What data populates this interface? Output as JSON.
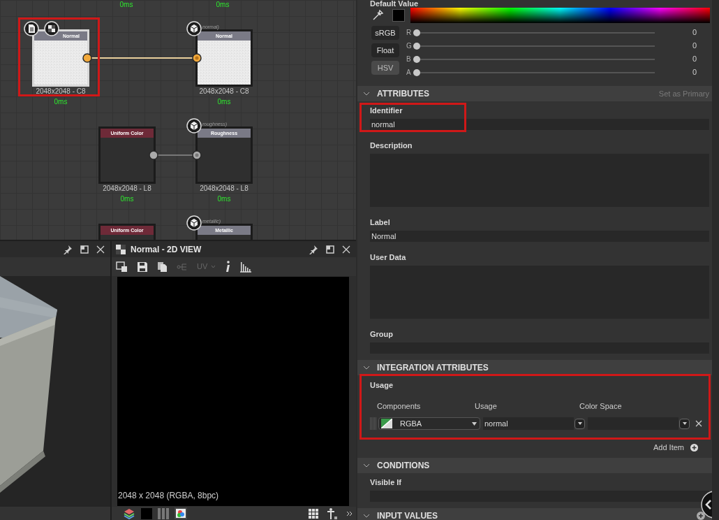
{
  "graph": {
    "top_times": [
      "0ms",
      "0ms"
    ],
    "nodes": [
      {
        "kind": "input",
        "title": "Normal",
        "color": "#7a7a86",
        "light_preview": true,
        "selected": true,
        "highlighted": true,
        "size_label": "2048x2048 - C8",
        "time": "0ms"
      },
      {
        "kind": "output",
        "title": "Normal",
        "subtitle": "normal)",
        "color": "#7a7a86",
        "light_preview": true,
        "selected": false,
        "highlighted": false,
        "size_label": "2048x2048 - C8",
        "time": "0ms"
      },
      {
        "kind": "uniform",
        "title": "Uniform Color",
        "color": "#6e2a38",
        "light_preview": false,
        "selected": false,
        "highlighted": false,
        "size_label": "2048x2048 - L8",
        "time": "0ms"
      },
      {
        "kind": "output",
        "title": "Roughness",
        "subtitle": "roughness)",
        "color": "#7a7a86",
        "light_preview": false,
        "selected": false,
        "highlighted": false,
        "size_label": "2048x2048 - L8",
        "time": "0ms"
      },
      {
        "kind": "uniform",
        "title": "Uniform Color",
        "color": "#6e2a38",
        "light_preview": false,
        "selected": false,
        "highlighted": false
      },
      {
        "kind": "output",
        "title": "Metallic",
        "subtitle": "metallic)",
        "color": "#7a7a86",
        "light_preview": false,
        "selected": false,
        "highlighted": false
      }
    ]
  },
  "view_2d": {
    "title": "Normal - 2D VIEW",
    "uv_selector": {
      "label": "UV",
      "disabled": true
    },
    "image_info": "2048 x 2048 (RGBA, 8bpc)"
  },
  "properties": {
    "default_value": {
      "label": "Default Value",
      "color": "#000000",
      "modes": [
        {
          "label": "sRGB",
          "selected": false
        },
        {
          "label": "Float",
          "selected": false
        },
        {
          "label": "HSV",
          "selected": true
        }
      ],
      "channels": [
        {
          "name": "R",
          "level": 0,
          "reading": "0"
        },
        {
          "name": "G",
          "level": 0,
          "reading": "0"
        },
        {
          "name": "B",
          "level": 0,
          "reading": "0"
        },
        {
          "name": "A",
          "level": 0,
          "reading": "0"
        }
      ]
    },
    "sections": [
      {
        "title": "ATTRIBUTES",
        "expanded": true,
        "action": "Set as Primary",
        "fields": [
          {
            "kind": "line",
            "label": "Identifier",
            "value": "normal",
            "highlighted": true
          },
          {
            "kind": "area",
            "label": "Description"
          },
          {
            "kind": "line",
            "label": "Label",
            "value": "Normal"
          },
          {
            "kind": "area",
            "label": "User Data"
          },
          {
            "kind": "line",
            "label": "Group"
          }
        ]
      },
      {
        "title": "INTEGRATION ATTRIBUTES",
        "expanded": true,
        "fields": [
          {
            "kind": "usage",
            "label": "Usage",
            "highlighted": true,
            "columns": [
              "Components",
              "Usage",
              "Color Space"
            ],
            "rows": [
              {
                "components": "RGBA",
                "usage": "normal"
              }
            ],
            "add_item": "Add Item"
          }
        ]
      },
      {
        "title": "CONDITIONS",
        "expanded": true,
        "fields": [
          {
            "kind": "line",
            "label": "Visible If"
          }
        ]
      },
      {
        "title": "INPUT VALUES",
        "expanded": true,
        "addable": true
      }
    ]
  }
}
